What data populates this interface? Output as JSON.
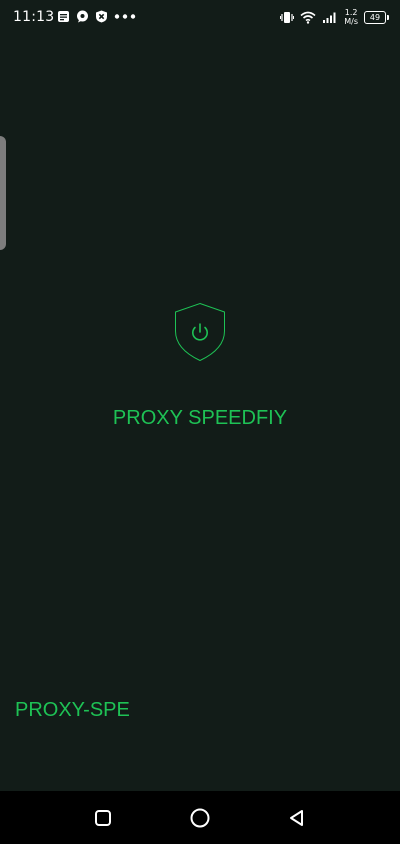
{
  "status_bar": {
    "time": "11:13",
    "left_icons": [
      "message-icon",
      "chat-bubble-icon",
      "blocked-app-icon",
      "more-dots-icon"
    ],
    "right_icons": [
      "vibrate-icon",
      "wifi-icon",
      "signal-icon"
    ],
    "net_speed_value": "1.2",
    "net_speed_unit": "M/s",
    "battery_level": "49"
  },
  "main": {
    "app_title": "PROXY SPEEDFIY",
    "shield_icon": "shield-power-icon",
    "accent_color": "#1ec255",
    "footer_label": "PROXY-SPE"
  },
  "nav_bar": {
    "buttons": [
      "recent-apps-icon",
      "home-icon",
      "back-icon"
    ]
  }
}
